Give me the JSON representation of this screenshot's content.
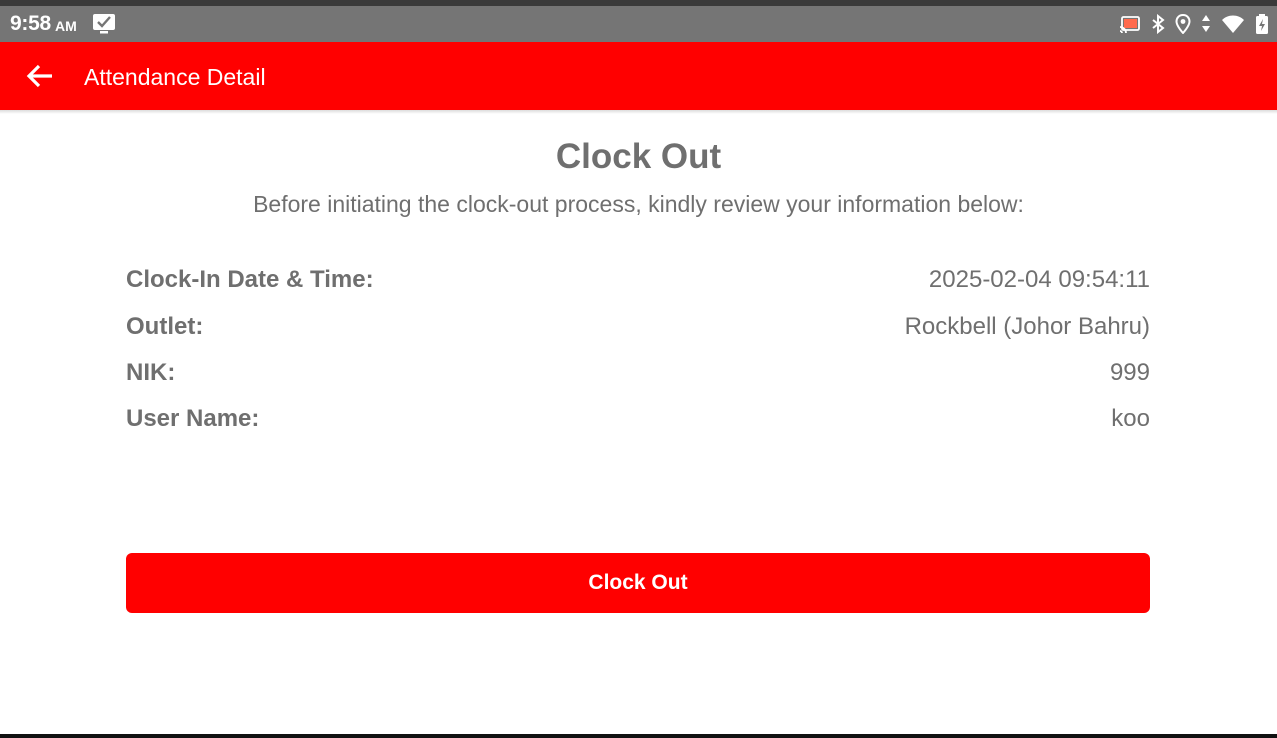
{
  "status_bar": {
    "time": "9:58",
    "ampm": "AM",
    "icons": [
      "checklist-notification-icon",
      "cast-icon",
      "bluetooth-icon",
      "location-icon",
      "data-arrows-icon",
      "wifi-icon",
      "battery-charging-icon"
    ]
  },
  "app_bar": {
    "title": "Attendance Detail",
    "back_icon": "arrow-left-icon",
    "color": "#ff0000"
  },
  "main": {
    "heading": "Clock Out",
    "subheading": "Before initiating the clock-out process, kindly review your information below:",
    "details": [
      {
        "label": "Clock-In Date & Time:",
        "value": "2025-02-04 09:54:11"
      },
      {
        "label": "Outlet:",
        "value": "Rockbell (Johor Bahru)"
      },
      {
        "label": "NIK:",
        "value": "999"
      },
      {
        "label": "User Name:",
        "value": "koo"
      }
    ],
    "button_label": "Clock Out",
    "accent_color": "#ff0000",
    "text_color": "#6f6f6f"
  }
}
